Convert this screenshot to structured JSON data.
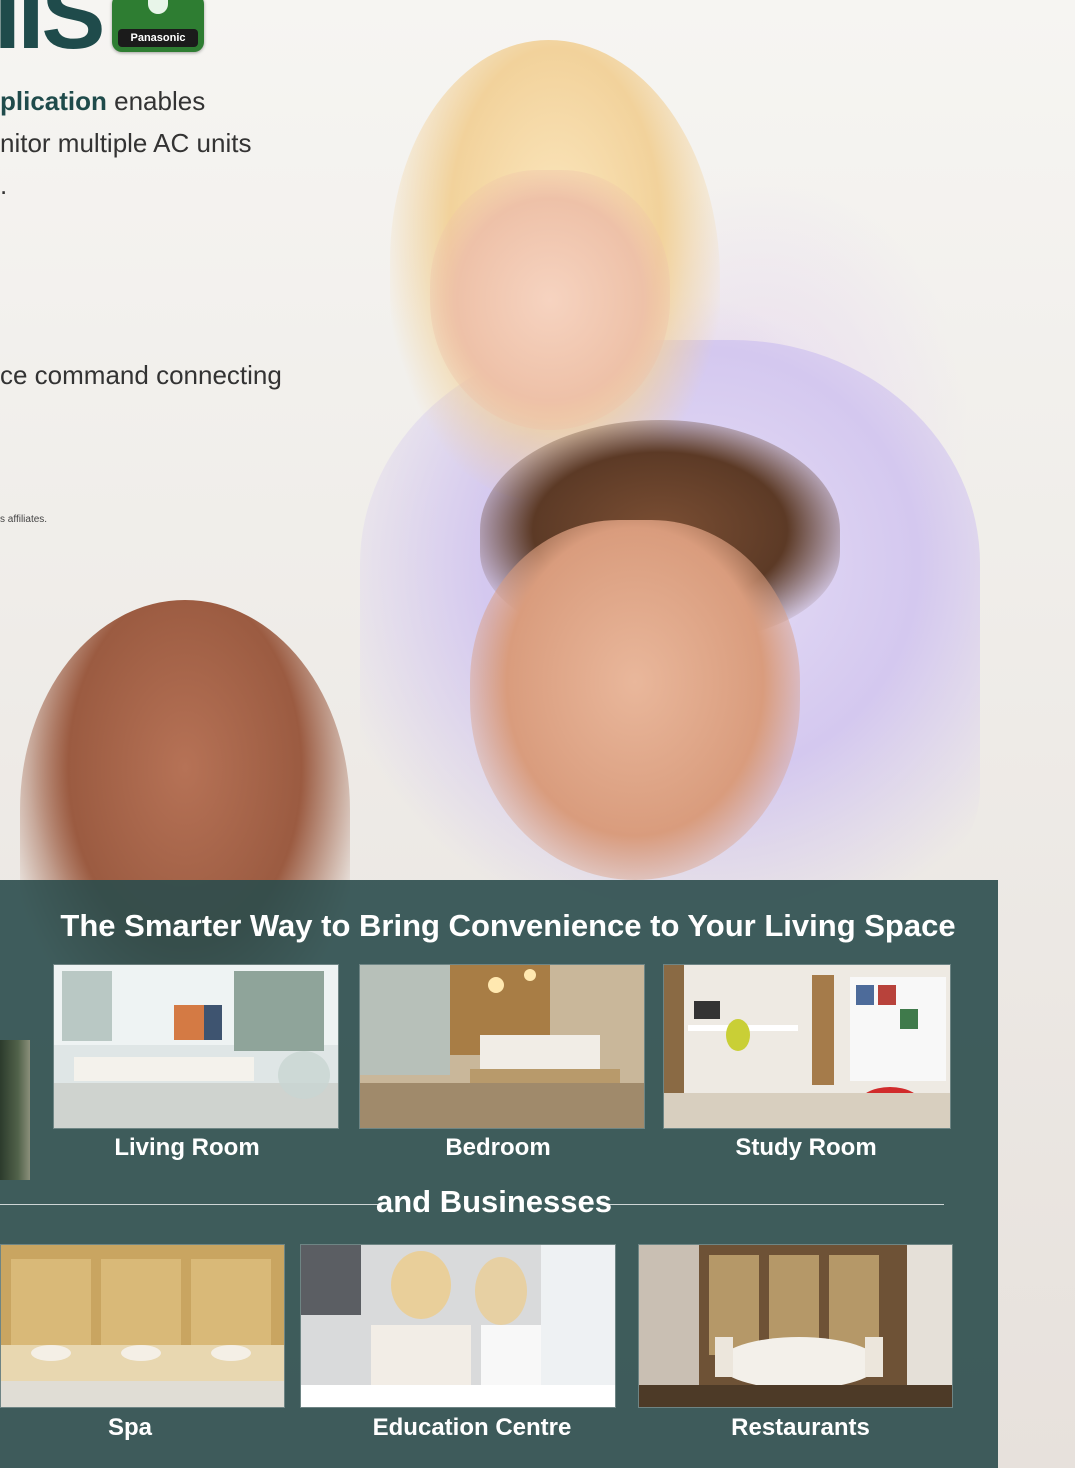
{
  "header": {
    "logo_text": "IIS",
    "app_icon_brand": "Panasonic",
    "intro_bold": "plication",
    "intro_line1_rest": " enables",
    "intro_line2": "nitor multiple AC units",
    "intro_line3": ".",
    "command_text": "ce command connecting",
    "affiliates_text": "s affiliates."
  },
  "panel": {
    "title": "The Smarter Way to Bring Convenience to Your Living Space",
    "home_spaces": [
      {
        "label": "Living Room"
      },
      {
        "label": "Bedroom"
      },
      {
        "label": "Study Room"
      }
    ],
    "business_title": "and Businesses",
    "business_spaces": [
      {
        "label": "Spa"
      },
      {
        "label": "Education Centre"
      },
      {
        "label": "Restaurants"
      }
    ]
  },
  "colors": {
    "brand_dark_teal": "#1f4b4b",
    "panel_bg": "#2b4c4c",
    "app_icon_green": "#2e7d32"
  }
}
